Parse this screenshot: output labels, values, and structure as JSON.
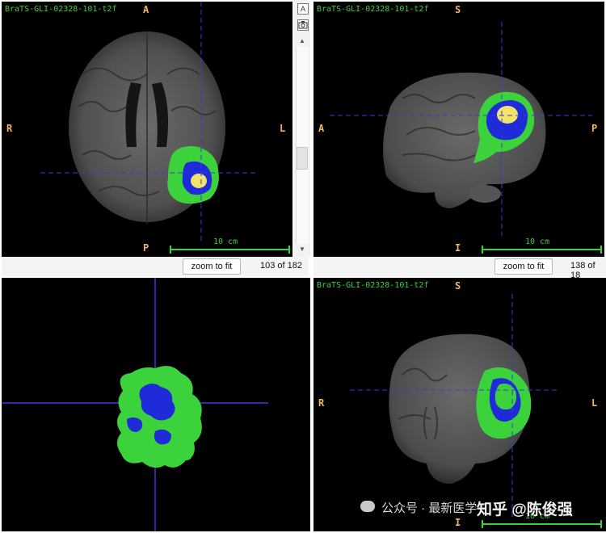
{
  "volume_name": "BraTS-GLI-02328-101-t2f",
  "axial": {
    "top": "A",
    "bottom": "P",
    "left": "R",
    "right": "L",
    "scale": "10 cm",
    "zoom_label": "zoom to fit",
    "slice": "103 of 182"
  },
  "sagittal": {
    "top": "S",
    "bottom": "I",
    "left": "A",
    "right": "P",
    "scale": "10 cm",
    "zoom_label": "zoom to fit",
    "slice": "138 of 18"
  },
  "coronal": {
    "top": "S",
    "bottom": "I",
    "left": "R",
    "right": "L",
    "scale": "10 cm"
  },
  "toolbar": {
    "label_toggle": "A",
    "camera": "camera-icon"
  },
  "watermark": {
    "platform": "公众号 · 最新医学",
    "title": "知乎 @陈俊强"
  },
  "colors": {
    "overlay_green": "#3cd23c",
    "overlay_blue": "#1f2ad8",
    "overlay_yellow": "#f2e36b",
    "crosshair": "#3b3bd8",
    "orientation": "#f0b46a"
  }
}
